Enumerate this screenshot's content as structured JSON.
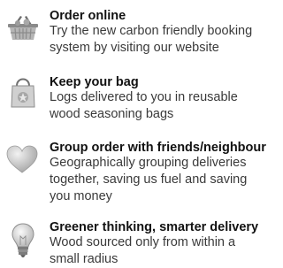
{
  "features": [
    {
      "icon": "basket-icon",
      "title": "Order online",
      "desc_lines": [
        "Try the new carbon friendly booking",
        "system by visiting our website"
      ]
    },
    {
      "icon": "bag-icon",
      "title": "Keep your bag",
      "desc_lines": [
        "Logs delivered to you in reusable",
        "wood seasoning bags"
      ]
    },
    {
      "icon": "heart-icon",
      "title": "Group order with friends/neighbour",
      "desc_lines": [
        "Geographically grouping deliveries",
        "together, saving us fuel and saving",
        "you money"
      ]
    },
    {
      "icon": "lightbulb-icon",
      "title": "Greener thinking, smarter delivery",
      "desc_lines": [
        "Wood sourced only from within a",
        "small radius"
      ]
    }
  ],
  "colors": {
    "title": "#111111",
    "text": "#3a3a3a",
    "icon_gray": "#9a9a9a"
  }
}
